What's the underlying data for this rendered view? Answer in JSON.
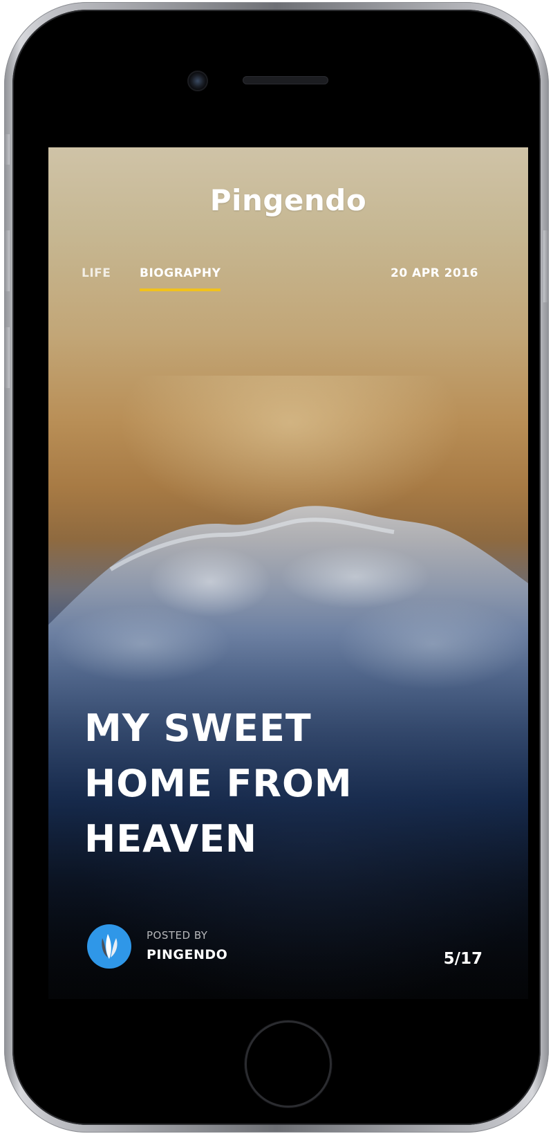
{
  "device": {
    "model": "iphone",
    "camera_icon": "camera-icon",
    "speaker_icon": "speaker-grille",
    "home_icon": "home-button"
  },
  "app": {
    "brand": "Pingendo"
  },
  "nav": {
    "items": [
      {
        "label": "LIFE",
        "active": false
      },
      {
        "label": "BIOGRAPHY",
        "active": true
      }
    ],
    "active_underline_color": "#f2c21b"
  },
  "post": {
    "date": "20 APR 2016",
    "title": "MY SWEET HOME FROM HEAVEN",
    "posted_by_label": "POSTED BY",
    "author": "PINGENDO",
    "author_avatar_icon": "pingendo-logo-icon",
    "avatar_color": "#2f97e8"
  },
  "pagination": {
    "text": "5/17"
  }
}
